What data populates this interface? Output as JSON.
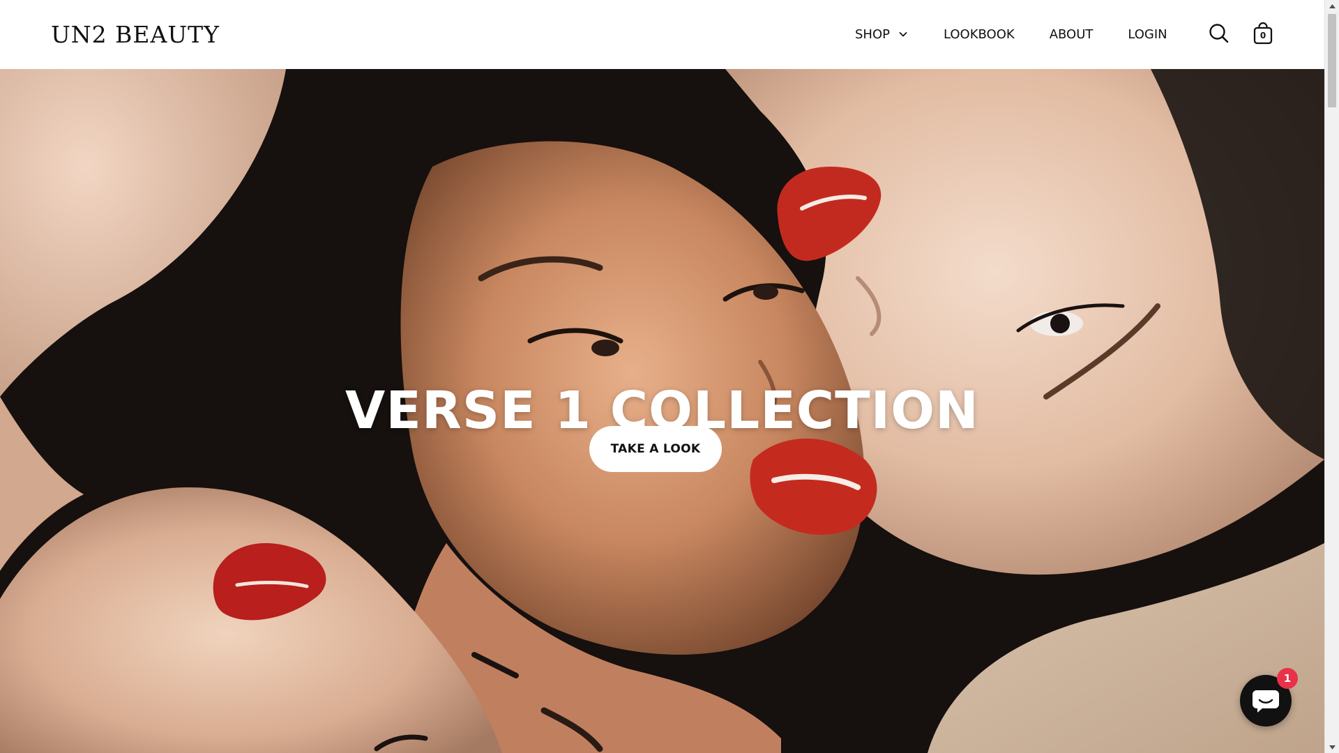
{
  "brand": {
    "logo_text": "UN2 BEAUTY"
  },
  "nav": {
    "shop_label": "SHOP",
    "lookbook_label": "LOOKBOOK",
    "about_label": "ABOUT",
    "login_label": "LOGIN"
  },
  "header_icons": {
    "search": "search-icon",
    "cart": "shopping-bag-icon",
    "cart_count": "0"
  },
  "hero": {
    "title": "VERSE 1 COLLECTION",
    "cta_label": "TAKE A LOOK"
  },
  "chat": {
    "icon": "chat-bubble-icon",
    "badge_count": "1",
    "badge_color": "#e8324a"
  },
  "colors": {
    "text": "#111111",
    "header_bg": "#ffffff",
    "lip_red": "#c8281e"
  }
}
